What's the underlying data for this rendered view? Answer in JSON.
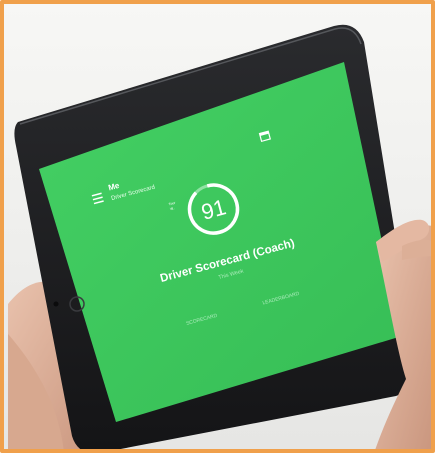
{
  "screen": {
    "app": {
      "user_name": "Me",
      "subtitle": "Driver Scorecard",
      "score": "91",
      "gauge_label_line1": "Tour",
      "gauge_label_line2": "W..",
      "title": "Driver Scorecard (Coach)",
      "period": "This Week",
      "tabs": [
        "SCORECARD",
        "LEADERBOARD"
      ]
    },
    "gauge_fraction": 0.91,
    "colors": {
      "frame_border": "#f0a04b",
      "screen_green": "#3ec95e",
      "tablet_body": "#1b1c1e"
    },
    "icons": [
      "menu-icon",
      "calendar-icon",
      "camera-icon",
      "home-button-icon"
    ]
  }
}
